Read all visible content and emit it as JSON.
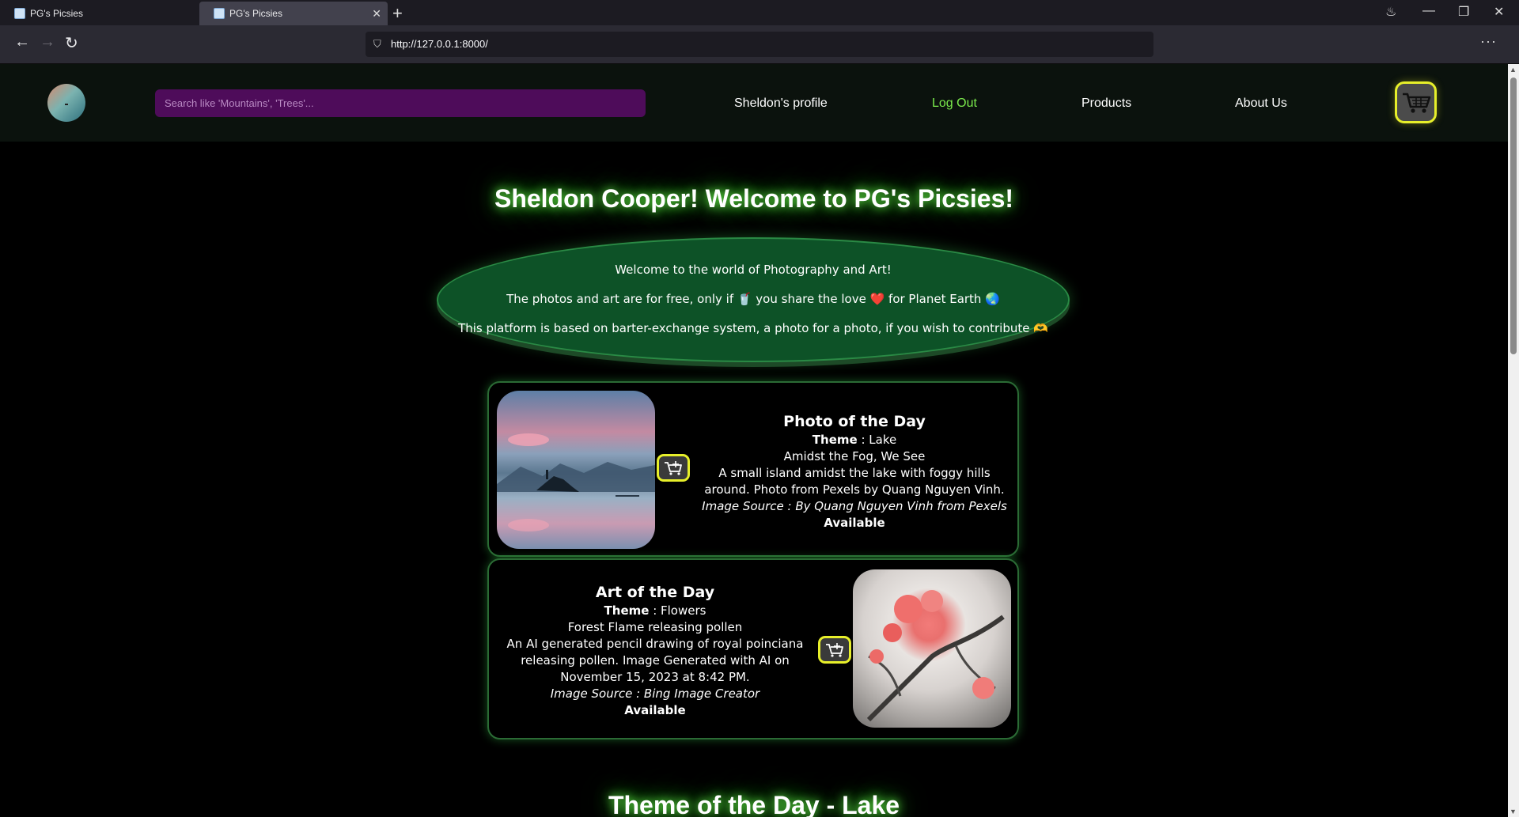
{
  "browser": {
    "tabs": [
      {
        "title": "PG's Picsies"
      },
      {
        "title": "PG's Picsies",
        "active": true
      }
    ],
    "url": "http://127.0.0.1:8000/"
  },
  "header": {
    "search": {
      "placeholder": "Search like 'Mountains', 'Trees'..."
    },
    "nav": {
      "profile": "Sheldon's profile",
      "logout": "Log Out",
      "products": "Products",
      "about": "About Us"
    }
  },
  "welcome": {
    "title": "Sheldon Cooper! Welcome to PG's Picsies!",
    "line1": "Welcome to the world of Photography and Art!",
    "line2": "The photos and art are for free, only if 🥤 you share the love ❤️ for Planet Earth 🌏",
    "line3": "This platform is based on barter-exchange system, a photo for a photo, if you wish to contribute 🫶"
  },
  "photo_of_day": {
    "heading": "Photo of the Day",
    "theme_label": "Theme",
    "theme": "Lake",
    "title": "Amidst the Fog, We See",
    "description": "A small island amidst the lake with foggy hills around. Photo from Pexels by Quang Nguyen Vinh.",
    "source": "Image Source : By Quang Nguyen Vinh from Pexels",
    "status": "Available"
  },
  "art_of_day": {
    "heading": "Art of the Day",
    "theme_label": "Theme",
    "theme": "Flowers",
    "title": "Forest Flame releasing pollen",
    "description": "An AI generated pencil drawing of royal poinciana releasing pollen. Image Generated with AI on November 15, 2023 at 8:42 PM.",
    "source": "Image Source : Bing Image Creator",
    "status": "Available"
  },
  "theme_section": {
    "title": "Theme of the Day - Lake"
  },
  "colors": {
    "accent_green": "#7bea4c",
    "search_bg": "#4e0c5a",
    "cart_border": "#e7ef2a",
    "oval_bg": "#0d5227"
  }
}
